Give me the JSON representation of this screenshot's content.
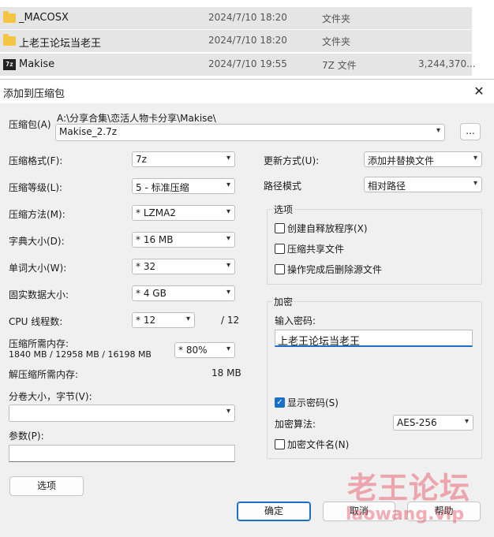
{
  "file_list": [
    {
      "name": "_MACOSX",
      "date": "2024/7/10 18:20",
      "type": "文件夹",
      "size": "",
      "icon": "folder-icon"
    },
    {
      "name": "上老王论坛当老王",
      "date": "2024/7/10 18:20",
      "type": "文件夹",
      "size": "",
      "icon": "folder-icon"
    },
    {
      "name": "Makise",
      "date": "2024/7/10 19:55",
      "type": "7Z 文件",
      "size": "3,244,370...",
      "icon": "7z-archive-icon"
    }
  ],
  "dialog": {
    "title": "添加到压缩包",
    "close_glyph": "✕",
    "archive_label": "压缩包(A)",
    "archive_path": "A:\\分享合集\\恋活人物卡分享\\Makise\\",
    "archive_name": "Makise_2.7z",
    "browse_label": "...",
    "format_label": "压缩格式(F):",
    "format_value": "7z",
    "level_label": "压缩等级(L):",
    "level_value": "5 - 标准压缩",
    "method_label": "压缩方法(M):",
    "method_value": "* LZMA2",
    "dict_label": "字典大小(D):",
    "dict_value": "* 16 MB",
    "word_label": "单词大小(W):",
    "word_value": "* 32",
    "solid_label": "固实数据大小:",
    "solid_value": "* 4 GB",
    "cpu_label": "CPU 线程数:",
    "cpu_value": "* 12",
    "cpu_total": "/ 12",
    "mem_label": "压缩所需内存:",
    "mem_detail": "1840 MB / 12958 MB / 16198 MB",
    "mem_value": "* 80%",
    "decomp_label": "解压缩所需内存:",
    "decomp_value": "18 MB",
    "split_label": "分卷大小，字节(V):",
    "split_value": "",
    "params_label": "参数(P):",
    "params_value": "",
    "options_button": "选项",
    "update_label": "更新方式(U):",
    "update_value": "添加并替换文件",
    "path_label": "路径模式",
    "path_value": "相对路径",
    "options_group": {
      "title": "选项",
      "sfx": "创建自释放程序(X)",
      "shared": "压缩共享文件",
      "delete": "操作完成后删除源文件"
    },
    "encrypt_group": {
      "title": "加密",
      "password_label": "输入密码:",
      "password_value": "上老王论坛当老王",
      "show_password": "显示密码(S)",
      "check_glyph": "✓",
      "method_label": "加密算法:",
      "method_value": "AES-256",
      "encrypt_names": "加密文件名(N)"
    },
    "ok_button": "确定",
    "cancel_button": "取消",
    "help_button": "帮助"
  },
  "watermark": {
    "line1": "老王论坛",
    "line2": "laowang.vip"
  }
}
